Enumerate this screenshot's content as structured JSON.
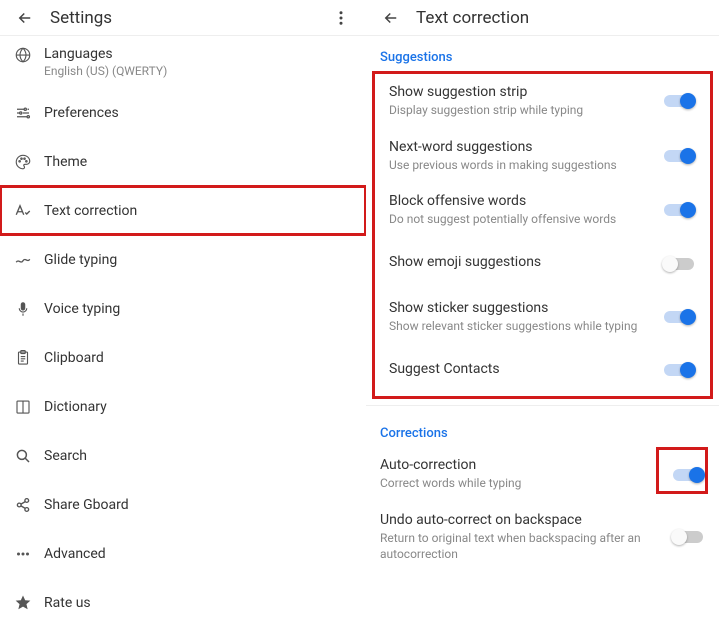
{
  "left": {
    "title": "Settings",
    "items": [
      {
        "icon": "globe-icon",
        "label": "Languages",
        "sub": "English (US) (QWERTY)"
      },
      {
        "icon": "sliders-icon",
        "label": "Preferences"
      },
      {
        "icon": "palette-icon",
        "label": "Theme"
      },
      {
        "icon": "text-correction-icon",
        "label": "Text correction"
      },
      {
        "icon": "glide-icon",
        "label": "Glide typing"
      },
      {
        "icon": "mic-icon",
        "label": "Voice typing"
      },
      {
        "icon": "clipboard-icon",
        "label": "Clipboard"
      },
      {
        "icon": "book-icon",
        "label": "Dictionary"
      },
      {
        "icon": "search-icon",
        "label": "Search"
      },
      {
        "icon": "share-icon",
        "label": "Share Gboard"
      },
      {
        "icon": "dots-icon",
        "label": "Advanced"
      },
      {
        "icon": "star-icon",
        "label": "Rate us"
      }
    ]
  },
  "right": {
    "title": "Text correction",
    "sections": {
      "suggestions": {
        "header": "Suggestions",
        "items": [
          {
            "title": "Show suggestion strip",
            "desc": "Display suggestion strip while typing",
            "on": true
          },
          {
            "title": "Next-word suggestions",
            "desc": "Use previous words in making suggestions",
            "on": true
          },
          {
            "title": "Block offensive words",
            "desc": "Do not suggest potentially offensive words",
            "on": true
          },
          {
            "title": "Show emoji suggestions",
            "desc": "",
            "on": false
          },
          {
            "title": "Show sticker suggestions",
            "desc": "Show relevant sticker suggestions while typing",
            "on": true
          },
          {
            "title": "Suggest Contacts",
            "desc": "",
            "on": true
          }
        ]
      },
      "corrections": {
        "header": "Corrections",
        "items": [
          {
            "title": "Auto-correction",
            "desc": "Correct words while typing",
            "on": true
          },
          {
            "title": "Undo auto-correct on backspace",
            "desc": "Return to original text when backspacing after an autocorrection",
            "on": false
          }
        ]
      }
    }
  }
}
